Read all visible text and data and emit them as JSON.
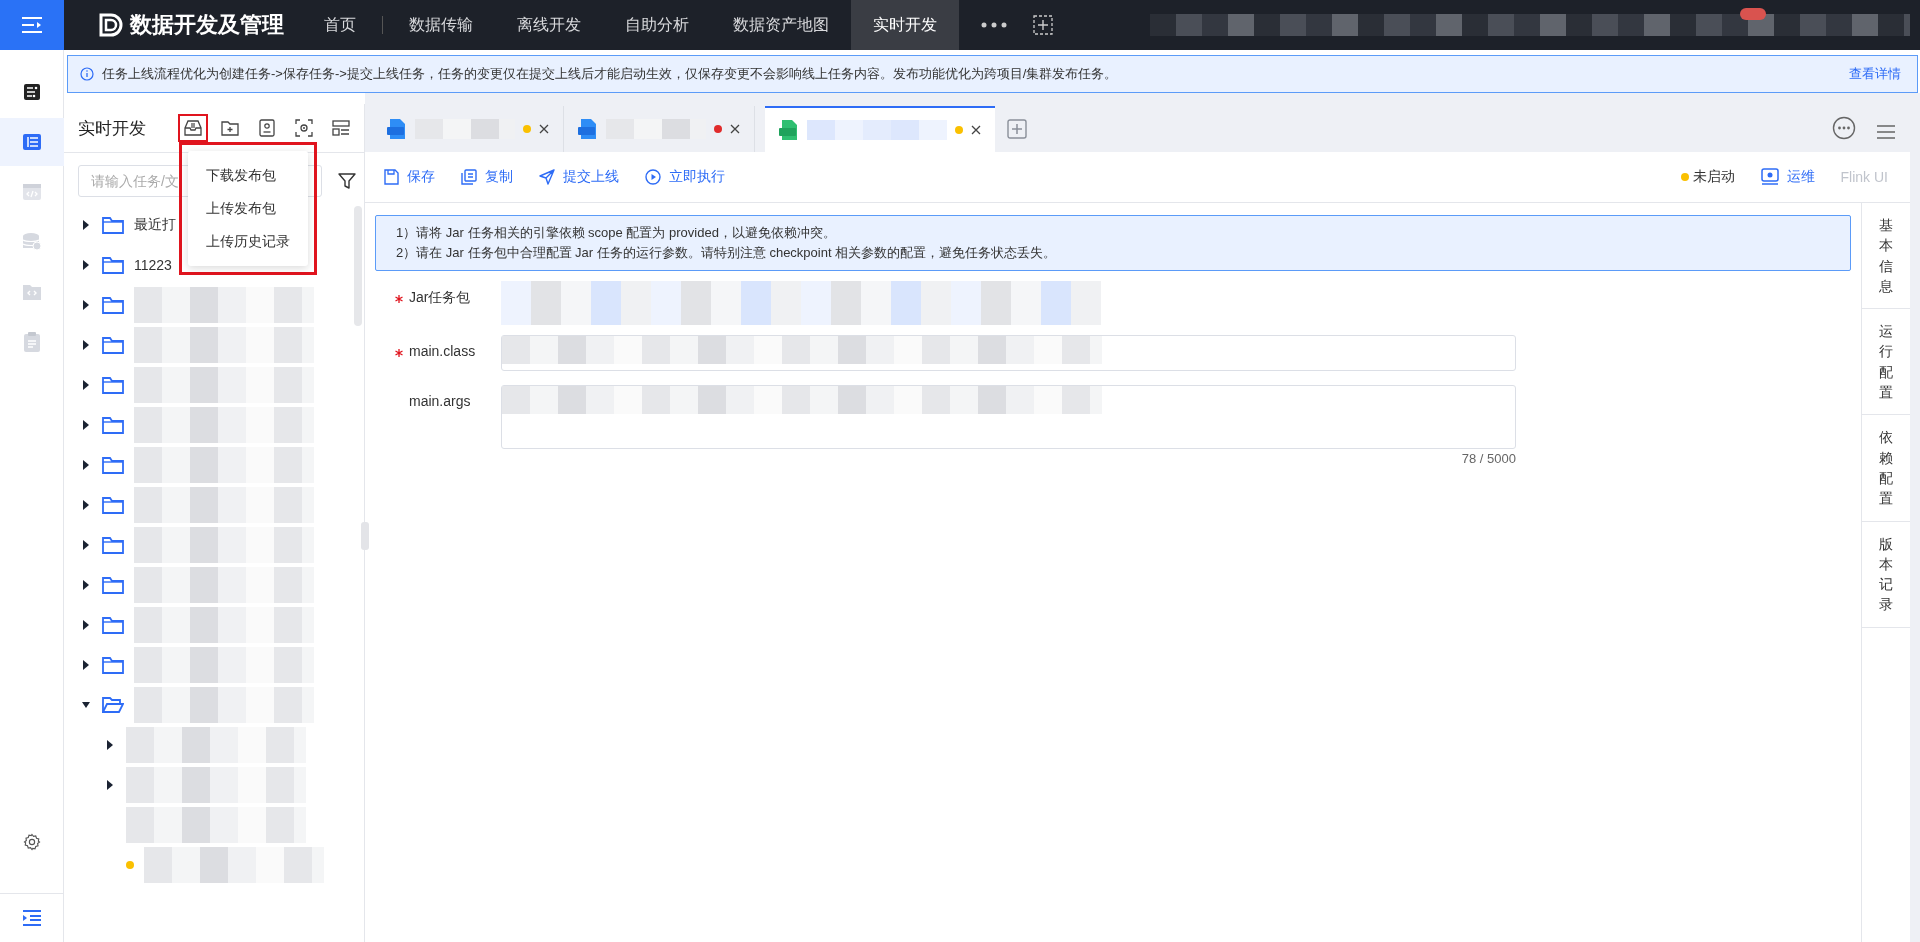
{
  "top_bar": {
    "title": "数据开发及管理",
    "nav": [
      {
        "label": "首页",
        "selected": false
      },
      {
        "label": "数据传输",
        "selected": false
      },
      {
        "label": "离线开发",
        "selected": false
      },
      {
        "label": "自助分析",
        "selected": false
      },
      {
        "label": "数据资产地图",
        "selected": false
      },
      {
        "label": "实时开发",
        "selected": true
      }
    ],
    "notification_badge": true
  },
  "rail": {
    "items": [
      {
        "kind": "list",
        "selected": false
      },
      {
        "kind": "table",
        "selected": true
      },
      {
        "kind": "code",
        "selected": false
      },
      {
        "kind": "database",
        "selected": false
      },
      {
        "kind": "folder-code",
        "selected": false
      },
      {
        "kind": "clipboard",
        "selected": false
      }
    ]
  },
  "notice": {
    "text": "任务上线流程优化为创建任务->保存任务->提交上线任务，任务的变更仅在提交上线后才能启动生效，仅保存变更不会影响线上任务内容。发布功能优化为跨项目/集群发布任务。",
    "link": "查看详情"
  },
  "panel": {
    "title": "实时开发",
    "tools": [
      {
        "kind": "package",
        "highlighted": true
      },
      {
        "kind": "new-folder",
        "highlighted": false
      },
      {
        "kind": "badge",
        "highlighted": false
      },
      {
        "kind": "locate",
        "highlighted": false
      },
      {
        "kind": "layout",
        "highlighted": false
      }
    ],
    "menu": {
      "highlighted": true,
      "items": [
        "下载发布包",
        "上传发布包",
        "上传历史记录"
      ]
    },
    "search": {
      "placeholder": "请输入任务/文"
    },
    "tree": [
      {
        "label": "最近打",
        "expanded": false
      },
      {
        "label": "11223",
        "expanded": false
      },
      {
        "expanded": false
      },
      {
        "expanded": false
      },
      {
        "expanded": false
      },
      {
        "expanded": false
      },
      {
        "expanded": false
      },
      {
        "expanded": false
      },
      {
        "expanded": false
      },
      {
        "expanded": false
      },
      {
        "expanded": false
      },
      {
        "expanded": false
      },
      {
        "expanded": true,
        "children": [
          {
            "expanded": false
          },
          {
            "expanded": false
          },
          {
            "kind": "file"
          },
          {
            "kind": "file",
            "color": "#fac000"
          }
        ]
      }
    ]
  },
  "tabs": [
    {
      "kind": "sql",
      "color": "#fac000",
      "selected": false
    },
    {
      "kind": "sql",
      "color": "#e02b2b",
      "selected": false
    },
    {
      "kind": "jar",
      "color": "#fac000",
      "selected": true
    }
  ],
  "toolbar": {
    "actions": [
      {
        "kind": "save",
        "label": "保存"
      },
      {
        "kind": "copy",
        "label": "复制"
      },
      {
        "kind": "submit",
        "label": "提交上线"
      },
      {
        "kind": "run",
        "label": "立即执行"
      }
    ],
    "status": {
      "label": "未启动",
      "color": "#fac000"
    },
    "ops": "运维",
    "flink_ui": {
      "label": "Flink UI",
      "disabled": true
    }
  },
  "info": [
    "1）请将 Jar 任务相关的引擎依赖 scope 配置为 provided，以避免依赖冲突。",
    "2）请在 Jar 任务包中合理配置 Jar 任务的运行参数。请特别注意 checkpoint 相关参数的配置，避免任务状态丢失。"
  ],
  "form": [
    {
      "kind": "select",
      "label": "Jar任务包",
      "required": true
    },
    {
      "kind": "input",
      "label": "main.class",
      "required": true
    },
    {
      "kind": "textarea",
      "label": "main.args",
      "required": false,
      "counter": "78 / 5000"
    }
  ],
  "side_tabs": [
    "基本信息",
    "运行配置",
    "依赖配置",
    "版本记录"
  ]
}
